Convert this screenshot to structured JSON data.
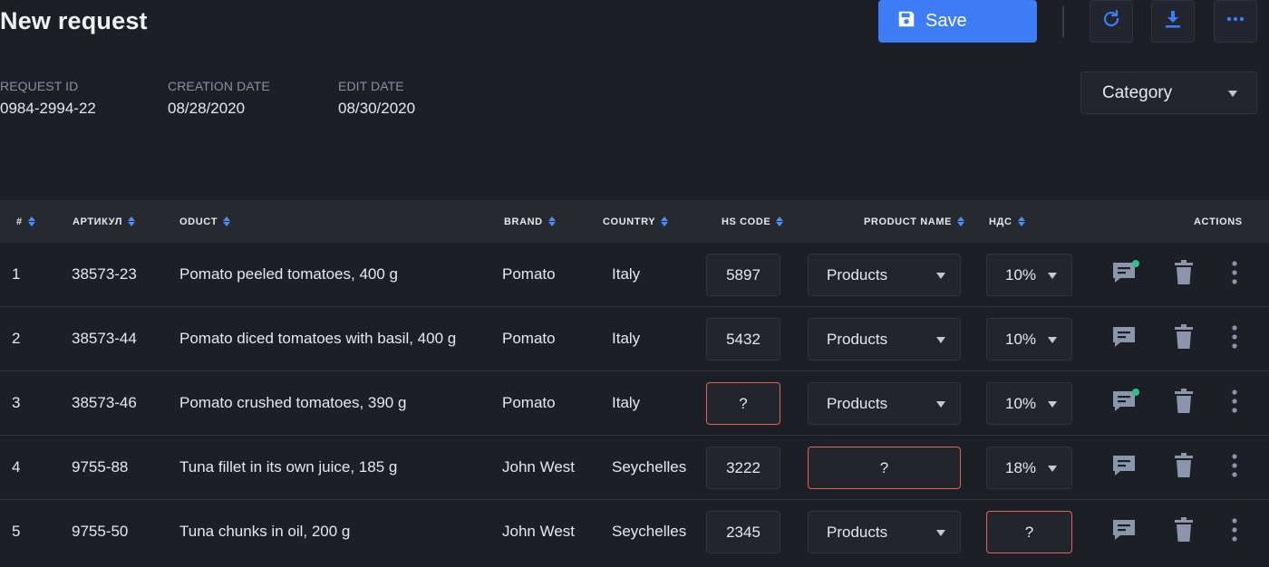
{
  "header": {
    "title": "New request",
    "save_label": "Save",
    "accent_color": "#3d7ef6"
  },
  "meta": {
    "request_id": {
      "label": "REQUEST ID",
      "value": "0984-2994-22"
    },
    "creation_date": {
      "label": "CREATION DATE",
      "value": "08/28/2020"
    },
    "edit_date": {
      "label": "EDIT DATE",
      "value": "08/30/2020"
    }
  },
  "category": {
    "value": "Category"
  },
  "table": {
    "columns": {
      "num": "#",
      "article": "АРТИКУЛ",
      "product": "ODUCT",
      "brand": "BRAND",
      "country": "COUNTRY",
      "hs_code": "HS CODE",
      "product_name": "PRODUCT NAME",
      "vat": "НДС",
      "actions": "ACTIONS"
    },
    "rows": [
      {
        "num": "1",
        "article": "38573-23",
        "product": "Pomato peeled tomatoes, 400 g",
        "brand": "Pomato",
        "country": "Italy",
        "hs_code": "5897",
        "product_name": "Products",
        "vat": "10%"
      },
      {
        "num": "2",
        "article": "38573-44",
        "product": "Pomato diced tomatoes with basil, 400 g",
        "brand": "Pomato",
        "country": "Italy",
        "hs_code": "5432",
        "product_name": "Products",
        "vat": "10%"
      },
      {
        "num": "3",
        "article": "38573-46",
        "product": "Pomato crushed tomatoes, 390 g",
        "brand": "Pomato",
        "country": "Italy",
        "hs_code": "?",
        "product_name": "Products",
        "vat": "10%"
      },
      {
        "num": "4",
        "article": "9755-88",
        "product": "Tuna fillet in its own juice, 185 g",
        "brand": "John West",
        "country": "Seychelles",
        "hs_code": "3222",
        "product_name": "?",
        "vat": "18%"
      },
      {
        "num": "5",
        "article": "9755-50",
        "product": "Tuna chunks in oil, 200 g",
        "brand": "John West",
        "country": "Seychelles",
        "hs_code": "2345",
        "product_name": "Products",
        "vat": "?"
      }
    ]
  },
  "icons": {
    "save": "floppy-disk-icon",
    "refresh": "refresh-icon",
    "download": "download-icon",
    "more": "more-horizontal-icon",
    "comment": "comment-icon",
    "delete": "trash-icon",
    "row_menu": "more-vertical-icon"
  },
  "colors": {
    "background": "#1c1f26",
    "error_border": "#e0625a",
    "notification_dot": "#2cc28a",
    "sort_arrow": "#4d8ff7",
    "icon_muted": "#8d95aa"
  }
}
